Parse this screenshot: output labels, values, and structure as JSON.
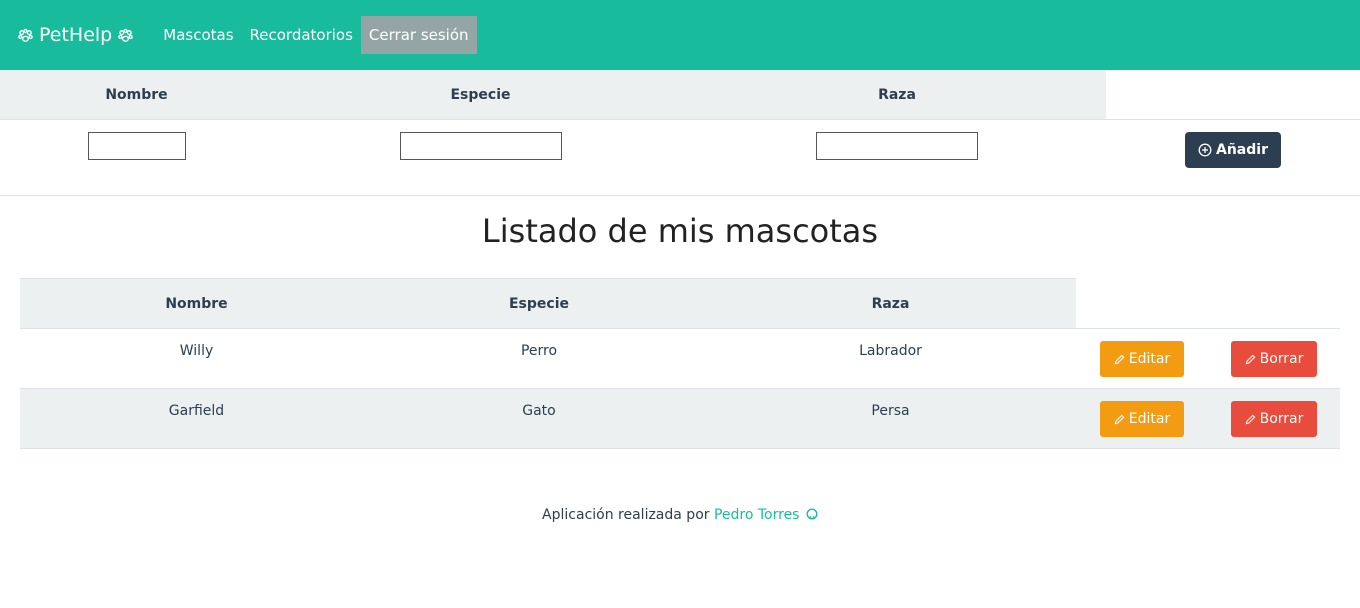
{
  "navbar": {
    "brand": "PetHelp",
    "links": [
      "Mascotas",
      "Recordatorios",
      "Cerrar sesión"
    ],
    "colors": {
      "background": "#18bc9c",
      "active_link_bg": "#95a5a6"
    }
  },
  "add_form": {
    "headers": [
      "Nombre",
      "Especie",
      "Raza"
    ],
    "inputs": {
      "nombre": "",
      "especie": "",
      "raza": ""
    },
    "add_button": "Añadir"
  },
  "page_title": "Listado de mis mascotas",
  "pets_table": {
    "headers": [
      "Nombre",
      "Especie",
      "Raza"
    ],
    "rows": [
      {
        "nombre": "Willy",
        "especie": "Perro",
        "raza": "Labrador"
      },
      {
        "nombre": "Garfield",
        "especie": "Gato",
        "raza": "Persa"
      }
    ],
    "edit_label": "Editar",
    "delete_label": "Borrar"
  },
  "footer": {
    "text": "Aplicación realizada por",
    "author": "Pedro Torres"
  }
}
